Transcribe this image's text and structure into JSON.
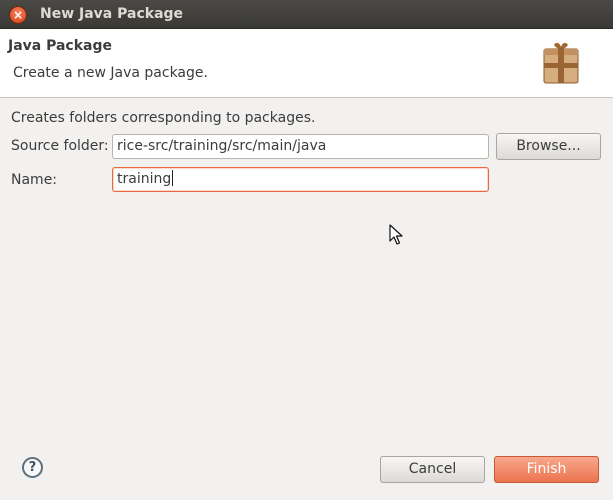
{
  "window": {
    "title": "New Java Package",
    "close_icon": "close-icon"
  },
  "banner": {
    "title": "Java Package",
    "description": "Create a new Java package.",
    "icon": "package-icon"
  },
  "form": {
    "description": "Creates folders corresponding to packages.",
    "source_folder_label": "Source folder:",
    "source_folder_value": "rice-src/training/src/main/java",
    "browse_label": "Browse...",
    "name_label": "Name:",
    "name_value": "training"
  },
  "footer": {
    "help_glyph": "?",
    "cancel_label": "Cancel",
    "finish_label": "Finish"
  },
  "colors": {
    "accent": "#ec7350",
    "titlebar": "#3c3b37",
    "focus_border": "#e9683c"
  }
}
